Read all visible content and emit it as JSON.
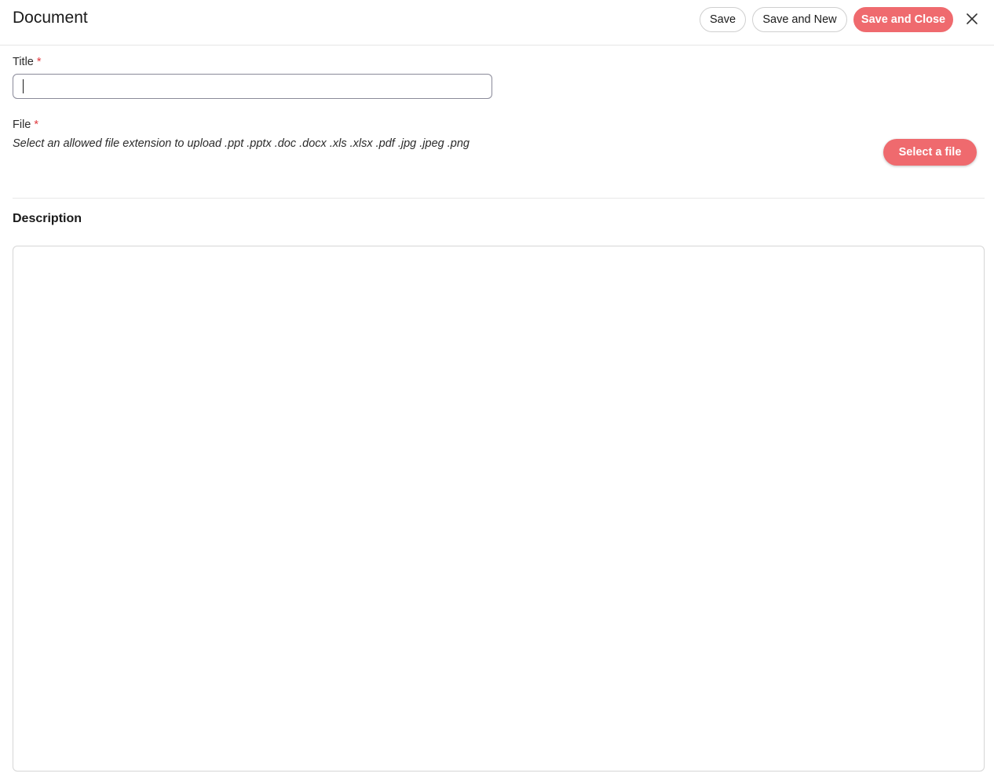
{
  "header": {
    "title": "Document",
    "buttons": {
      "save": "Save",
      "save_and_new": "Save and New",
      "save_and_close": "Save and Close"
    },
    "close_icon": "close-icon"
  },
  "form": {
    "title_field": {
      "label": "Title",
      "required_mark": "*",
      "value": "",
      "placeholder": ""
    },
    "file_field": {
      "label": "File",
      "required_mark": "*",
      "hint": "Select an allowed file extension to upload .ppt .pptx .doc .docx .xls .xlsx .pdf .jpg .jpeg .png",
      "select_button": "Select a file"
    },
    "description": {
      "heading": "Description",
      "value": ""
    }
  },
  "colors": {
    "accent": "#ef6a6e",
    "required": "#e0393e"
  }
}
